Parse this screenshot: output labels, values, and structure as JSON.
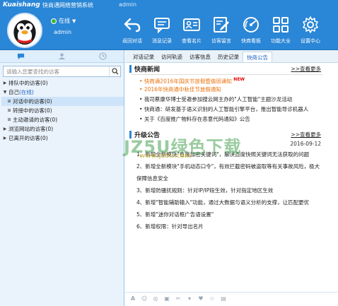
{
  "header": {
    "logo": "Kuaishang",
    "app_title": "快商通网络营销系统",
    "app_user": "admin",
    "status": "在线",
    "user_name": "admin",
    "toolbar": [
      {
        "label": "返回对话",
        "icon": "return-icon"
      },
      {
        "label": "消息记录",
        "icon": "message-record-icon"
      },
      {
        "label": "查看名片",
        "icon": "business-card-icon"
      },
      {
        "label": "访客留言",
        "icon": "visitor-message-icon"
      },
      {
        "label": "快商看板",
        "icon": "dashboard-icon"
      },
      {
        "label": "功能大全",
        "icon": "functions-icon"
      },
      {
        "label": "设置中心",
        "icon": "settings-icon"
      }
    ]
  },
  "left": {
    "search_placeholder": "请输入您要查找的访客",
    "tree": [
      {
        "label": "排队中的访客(0)",
        "indent": 0,
        "exp": "▶"
      },
      {
        "label": "自己",
        "online": "(在线)",
        "indent": 0,
        "exp": "▼"
      },
      {
        "label": "对话中的访客(0)",
        "indent": 1,
        "exp": "⊞"
      },
      {
        "label": "转接中的访客(0)",
        "indent": 1,
        "exp": "⊞"
      },
      {
        "label": "主动邀请的访客(0)",
        "indent": 1,
        "exp": "⊞"
      },
      {
        "label": "浏览网站的访客(0)",
        "indent": 0,
        "exp": "▶"
      },
      {
        "label": "已离开的访客(0)",
        "indent": 0,
        "exp": "▶"
      }
    ]
  },
  "right": {
    "tabs": [
      "对话记录",
      "访问轨迹",
      "访客信息",
      "历史记录",
      "快商公告"
    ],
    "active_tab": 4,
    "news": {
      "title": "快商新闻",
      "more": ">>查看更多",
      "items": [
        {
          "text": "快商通2016年国庆节放假暨值班通知",
          "highlight": true,
          "is_new": true,
          "new_label": "NEW",
          "side": "2"
        },
        {
          "text": "2016年快商通中秋佳节放假通知",
          "highlight": true,
          "is_new": false,
          "side": "2"
        },
        {
          "text": "我司蔡康华博士受邀参加搜云网主办的\"人工智能\"主题沙龙活动",
          "highlight": false,
          "is_new": false,
          "side": "2"
        },
        {
          "text": "快商通：研发基于语义识别的人工智能引擎平台，推出智能导诊机器人",
          "highlight": false,
          "is_new": false,
          "side": "2"
        },
        {
          "text": "关于《百度推广物料存在恶意代码通知》公告",
          "highlight": false,
          "is_new": false,
          "side": "2"
        }
      ]
    },
    "announce": {
      "title": "升级公告",
      "more": ">>查看更多",
      "date": "2016-09-12",
      "items": [
        "1、新增全新模块\"百度加密关键词\"，解决百度快照关键词无法获取的问题",
        "2、新增全新模块\"手机动态口令\"，有效拦截密码被盗取等有关事故风险，极大保障信息安全",
        "3、新增防骚扰规则：针对IP/IP段生效，针对指定地区生效",
        "4、新增\"智能辅助输入\"功能，通过大数据与语义分析的支撑，让匹配更优",
        "5、新增\"迷你对话框广告语设置\"",
        "6、新增权限：针对导出名片"
      ]
    },
    "input_icons": [
      "font-icon",
      "emoji-icon",
      "screenshot-icon",
      "image-icon",
      "scissors-icon",
      "quick-reply-icon",
      "heart-icon",
      "star-icon",
      "file-icon"
    ]
  },
  "watermark": {
    "main": "JZ5U绿色下载",
    "sub": "www.jz5u.com"
  }
}
